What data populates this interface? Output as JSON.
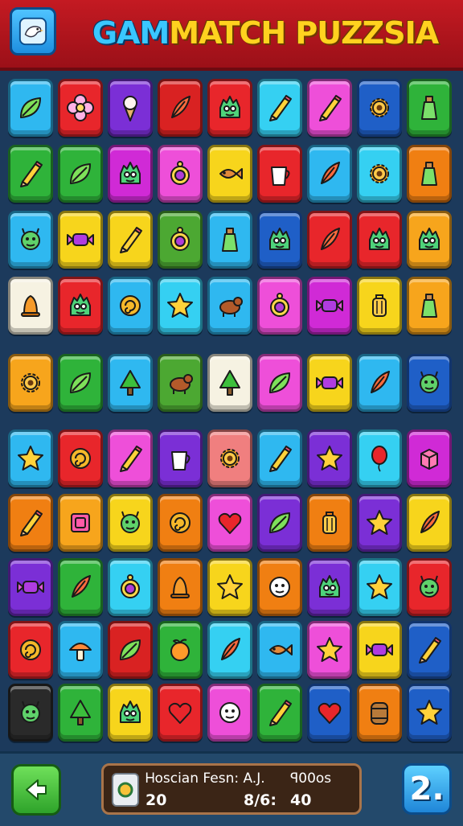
{
  "header": {
    "title_part1": "GAM",
    "title_part2": "MATCH PUZZSIA",
    "corner_icon": "bird-icon"
  },
  "board": {
    "rows": [
      [
        {
          "color": "#2fb8f0",
          "icon": "leaf-icon"
        },
        {
          "color": "#e8262b",
          "icon": "flower-icon"
        },
        {
          "color": "#7b2fd6",
          "icon": "ice-cream-icon"
        },
        {
          "color": "#d92222",
          "icon": "feather-icon"
        },
        {
          "color": "#e8262b",
          "icon": "monster-icon"
        },
        {
          "color": "#35d0f2",
          "icon": "pencil-icon"
        },
        {
          "color": "#ee4fd9",
          "icon": "pencil-icon"
        },
        {
          "color": "#1f5fc7",
          "icon": "gear-icon"
        },
        {
          "color": "#2fb33a",
          "icon": "bottle-icon"
        }
      ],
      [
        {
          "color": "#2fb33a",
          "icon": "pencil-icon"
        },
        {
          "color": "#2fb33a",
          "icon": "leaf-icon"
        },
        {
          "color": "#d02ad6",
          "icon": "monster-icon"
        },
        {
          "color": "#ee4fd9",
          "icon": "ring-icon"
        },
        {
          "color": "#f7d51c",
          "icon": "fish-icon"
        },
        {
          "color": "#e8262b",
          "icon": "cup-icon"
        },
        {
          "color": "#2fb8f0",
          "icon": "feather-icon"
        },
        {
          "color": "#35d0f2",
          "icon": "gear-icon"
        },
        {
          "color": "#f07f12",
          "icon": "bottle-icon"
        }
      ],
      [
        {
          "color": "#2fb8f0",
          "icon": "creature-icon"
        },
        {
          "color": "#f7d51c",
          "icon": "candy-icon"
        },
        {
          "color": "#f7d51c",
          "icon": "pencil-icon"
        },
        {
          "color": "#4ca832",
          "icon": "ring-icon"
        },
        {
          "color": "#2fb8f0",
          "icon": "bottle-icon"
        },
        {
          "color": "#1f5fc7",
          "icon": "monster-icon"
        },
        {
          "color": "#e8262b",
          "icon": "feather-icon"
        },
        {
          "color": "#e8262b",
          "icon": "monster-icon"
        },
        {
          "color": "#f7a51c",
          "icon": "monster-icon"
        }
      ],
      [
        {
          "color": "#f6f2e2",
          "icon": "bell-icon"
        },
        {
          "color": "#e8262b",
          "icon": "monster-icon"
        },
        {
          "color": "#2fb8f0",
          "icon": "swirl-icon"
        },
        {
          "color": "#35d0f2",
          "icon": "star-icon"
        },
        {
          "color": "#2fb8f0",
          "icon": "animal-icon"
        },
        {
          "color": "#ee4fd9",
          "icon": "ring-icon"
        },
        {
          "color": "#d02ad6",
          "icon": "candy-icon"
        },
        {
          "color": "#f7d51c",
          "icon": "lantern-icon"
        },
        {
          "color": "#f7a51c",
          "icon": "bottle-icon"
        }
      ],
      [
        {
          "color": "#f7a51c",
          "icon": "gear-icon"
        },
        {
          "color": "#2fb33a",
          "icon": "leaf-icon"
        },
        {
          "color": "#2fb8f0",
          "icon": "tree-icon"
        },
        {
          "color": "#4ca832",
          "icon": "animal-icon"
        },
        {
          "color": "#f6f2e2",
          "icon": "tree-icon"
        },
        {
          "color": "#ee4fd9",
          "icon": "leaf-icon"
        },
        {
          "color": "#f7d51c",
          "icon": "candy-icon"
        },
        {
          "color": "#2fb8f0",
          "icon": "feather-icon"
        },
        {
          "color": "#1f5fc7",
          "icon": "creature-icon"
        }
      ],
      [
        {
          "color": "#2fb8f0",
          "icon": "star-icon"
        },
        {
          "color": "#e8262b",
          "icon": "swirl-icon"
        },
        {
          "color": "#ee4fd9",
          "icon": "pencil-icon"
        },
        {
          "color": "#7b2fd6",
          "icon": "cup-icon"
        },
        {
          "color": "#f07f7f",
          "icon": "gear-icon"
        },
        {
          "color": "#2fb8f0",
          "icon": "pencil-icon"
        },
        {
          "color": "#7b2fd6",
          "icon": "star-icon"
        },
        {
          "color": "#35d0f2",
          "icon": "balloon-icon"
        },
        {
          "color": "#d02ad6",
          "icon": "cube-icon"
        }
      ],
      [
        {
          "color": "#f07f12",
          "icon": "pencil-icon"
        },
        {
          "color": "#f7a51c",
          "icon": "frame-icon"
        },
        {
          "color": "#f7d51c",
          "icon": "creature-icon"
        },
        {
          "color": "#f07f12",
          "icon": "swirl-icon"
        },
        {
          "color": "#ee4fd9",
          "icon": "heart-icon"
        },
        {
          "color": "#7b2fd6",
          "icon": "leaf-icon"
        },
        {
          "color": "#f07f12",
          "icon": "lantern-icon"
        },
        {
          "color": "#7b2fd6",
          "icon": "star-icon"
        },
        {
          "color": "#f7d51c",
          "icon": "feather-icon"
        }
      ],
      [
        {
          "color": "#7b2fd6",
          "icon": "candy-icon"
        },
        {
          "color": "#2fb33a",
          "icon": "feather-icon"
        },
        {
          "color": "#35d0f2",
          "icon": "ring-icon"
        },
        {
          "color": "#f07f12",
          "icon": "bell-icon"
        },
        {
          "color": "#f7d51c",
          "icon": "star-icon"
        },
        {
          "color": "#f07f12",
          "icon": "face-icon"
        },
        {
          "color": "#7b2fd6",
          "icon": "monster-icon"
        },
        {
          "color": "#35d0f2",
          "icon": "star-icon"
        },
        {
          "color": "#e8262b",
          "icon": "creature-icon"
        }
      ],
      [
        {
          "color": "#e8262b",
          "icon": "swirl-icon"
        },
        {
          "color": "#2fb8f0",
          "icon": "mushroom-icon"
        },
        {
          "color": "#d92222",
          "icon": "leaf-icon"
        },
        {
          "color": "#2fb33a",
          "icon": "fruit-icon"
        },
        {
          "color": "#35d0f2",
          "icon": "feather-icon"
        },
        {
          "color": "#2fb8f0",
          "icon": "fish-icon"
        },
        {
          "color": "#ee4fd9",
          "icon": "star-icon"
        },
        {
          "color": "#f7d51c",
          "icon": "candy-icon"
        },
        {
          "color": "#1f5fc7",
          "icon": "pencil-icon"
        }
      ],
      [
        {
          "color": "#2a2a2a",
          "icon": "creature-icon"
        },
        {
          "color": "#2fb33a",
          "icon": "tree-icon"
        },
        {
          "color": "#f7d51c",
          "icon": "monster-icon"
        },
        {
          "color": "#e8262b",
          "icon": "heart-icon"
        },
        {
          "color": "#ee4fd9",
          "icon": "face-icon"
        },
        {
          "color": "#2fb33a",
          "icon": "pencil-icon"
        },
        {
          "color": "#1f5fc7",
          "icon": "heart-icon"
        },
        {
          "color": "#f07f12",
          "icon": "barrel-icon"
        },
        {
          "color": "#1f5fc7",
          "icon": "star-icon"
        }
      ]
    ]
  },
  "footer": {
    "back_icon": "back-arrow-icon",
    "panel_icon": "gem-icon",
    "stat1_label": "Ꮋoscian Fesn: A.J.",
    "stat2_label": "ꟼ00os",
    "stat1_value": "20",
    "stat2_value": "8/6:",
    "stat3_value": "40",
    "level_label": "2."
  }
}
